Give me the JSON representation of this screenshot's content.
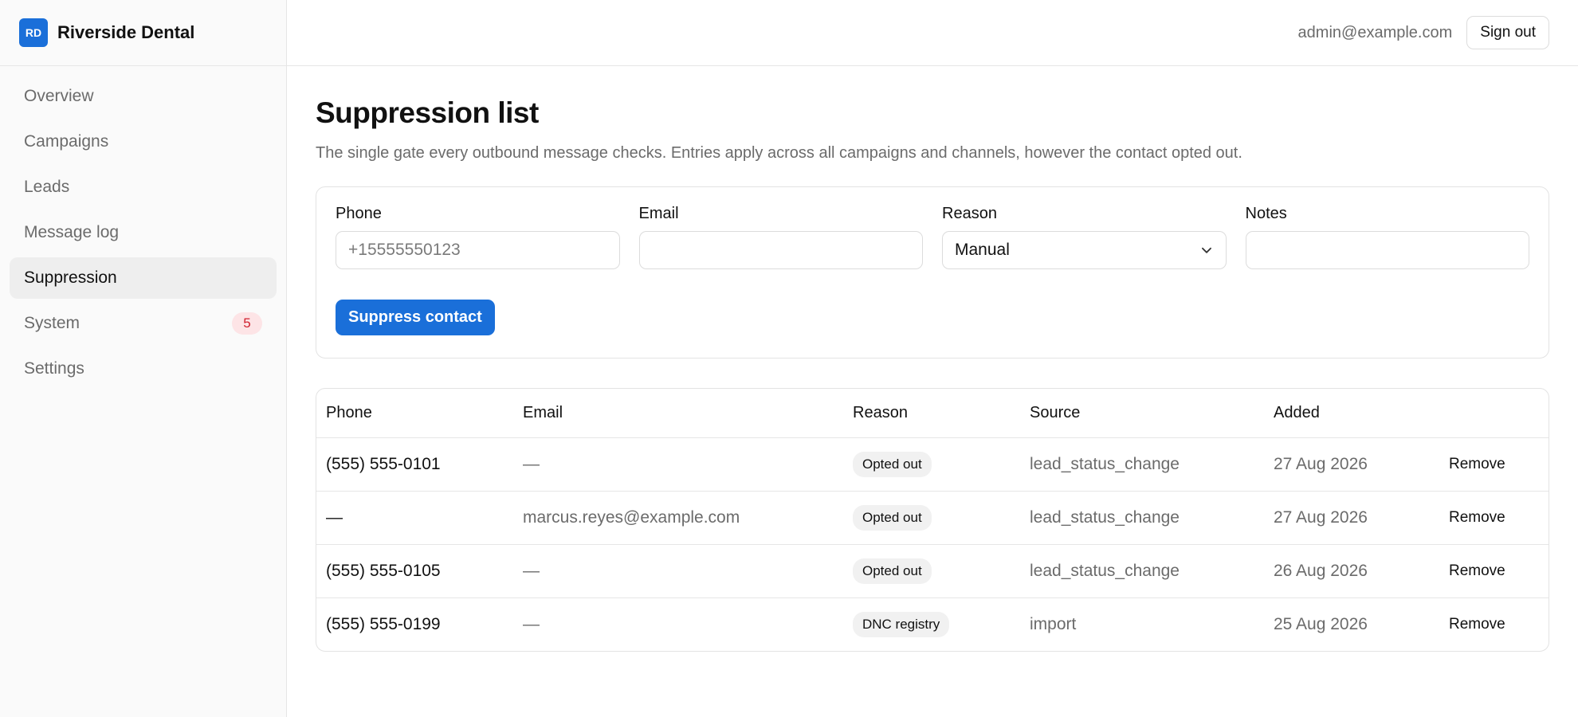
{
  "brand": {
    "logo": "RD",
    "name": "Riverside Dental",
    "accent": "#1a6fd9"
  },
  "sidebar": {
    "items": [
      {
        "label": "Overview",
        "active": false
      },
      {
        "label": "Campaigns",
        "active": false
      },
      {
        "label": "Leads",
        "active": false
      },
      {
        "label": "Message log",
        "active": false
      },
      {
        "label": "Suppression",
        "active": true
      },
      {
        "label": "System",
        "active": false,
        "badge": "5"
      },
      {
        "label": "Settings",
        "active": false
      }
    ]
  },
  "header": {
    "user_email": "admin@example.com",
    "signout_label": "Sign out"
  },
  "page": {
    "title": "Suppression list",
    "description": "The single gate every outbound message checks. Entries apply across all campaigns and channels, however the contact opted out."
  },
  "form": {
    "phone_label": "Phone",
    "phone_placeholder": "+15555550123",
    "phone_value": "",
    "email_label": "Email",
    "email_value": "",
    "reason_label": "Reason",
    "reason_value": "Manual",
    "notes_label": "Notes",
    "notes_value": "",
    "submit_label": "Suppress contact"
  },
  "table": {
    "columns": {
      "phone": "Phone",
      "email": "Email",
      "reason": "Reason",
      "source": "Source",
      "added": "Added"
    },
    "remove_label": "Remove",
    "rows": [
      {
        "phone": "(555) 555-0101",
        "email": "—",
        "reason": "Opted out",
        "source": "lead_status_change",
        "added": "27 Aug 2026"
      },
      {
        "phone": "—",
        "email": "marcus.reyes@example.com",
        "reason": "Opted out",
        "source": "lead_status_change",
        "added": "27 Aug 2026"
      },
      {
        "phone": "(555) 555-0105",
        "email": "—",
        "reason": "Opted out",
        "source": "lead_status_change",
        "added": "26 Aug 2026"
      },
      {
        "phone": "(555) 555-0199",
        "email": "—",
        "reason": "DNC registry",
        "source": "import",
        "added": "25 Aug 2026"
      }
    ]
  }
}
